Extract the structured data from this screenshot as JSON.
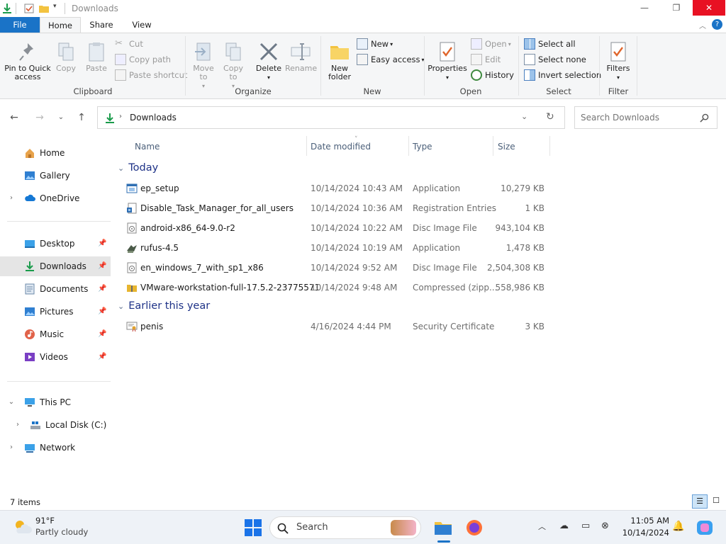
{
  "window": {
    "title": "Downloads"
  },
  "ribbon_tabs": [
    "File",
    "Home",
    "Share",
    "View"
  ],
  "ribbon": {
    "clipboard": {
      "label": "Clipboard",
      "pin": "Pin to Quick access",
      "copy": "Copy",
      "paste": "Paste",
      "cut": "Cut",
      "copy_path": "Copy path",
      "paste_shortcut": "Paste shortcut"
    },
    "organize": {
      "label": "Organize",
      "move_to": "Move to",
      "copy_to": "Copy to",
      "delete": "Delete",
      "rename": "Rename"
    },
    "new": {
      "label": "New",
      "new_folder": "New folder",
      "new_item": "New",
      "easy_access": "Easy access"
    },
    "open": {
      "label": "Open",
      "properties": "Properties",
      "open": "Open",
      "edit": "Edit",
      "history": "History"
    },
    "select": {
      "label": "Select",
      "select_all": "Select all",
      "select_none": "Select none",
      "invert": "Invert selection"
    },
    "filter": {
      "label": "Filter",
      "filters": "Filters"
    }
  },
  "address": {
    "path": "Downloads",
    "search_placeholder": "Search Downloads"
  },
  "nav": {
    "home": "Home",
    "gallery": "Gallery",
    "onedrive": "OneDrive",
    "desktop": "Desktop",
    "downloads": "Downloads",
    "documents": "Documents",
    "pictures": "Pictures",
    "music": "Music",
    "videos": "Videos",
    "this_pc": "This PC",
    "local_disk": "Local Disk (C:)",
    "network": "Network"
  },
  "columns": {
    "name": "Name",
    "date": "Date modified",
    "type": "Type",
    "size": "Size"
  },
  "groups": [
    {
      "label": "Today",
      "files": [
        {
          "name": "ep_setup",
          "date": "10/14/2024 10:43 AM",
          "type": "Application",
          "size": "10,279 KB",
          "icon": "app-icon"
        },
        {
          "name": "Disable_Task_Manager_for_all_users",
          "date": "10/14/2024 10:36 AM",
          "type": "Registration Entries",
          "size": "1 KB",
          "icon": "reg-icon"
        },
        {
          "name": "android-x86_64-9.0-r2",
          "date": "10/14/2024 10:22 AM",
          "type": "Disc Image File",
          "size": "943,104 KB",
          "icon": "disc-icon"
        },
        {
          "name": "rufus-4.5",
          "date": "10/14/2024 10:19 AM",
          "type": "Application",
          "size": "1,478 KB",
          "icon": "rufus-icon"
        },
        {
          "name": "en_windows_7_with_sp1_x86",
          "date": "10/14/2024 9:52 AM",
          "type": "Disc Image File",
          "size": "2,504,308 KB",
          "icon": "disc-icon"
        },
        {
          "name": "VMware-workstation-full-17.5.2-23775571",
          "date": "10/14/2024 9:48 AM",
          "type": "Compressed (zipp...",
          "size": "558,986 KB",
          "icon": "zip-icon"
        }
      ]
    },
    {
      "label": "Earlier this year",
      "files": [
        {
          "name": "penis",
          "date": "4/16/2024 4:44 PM",
          "type": "Security Certificate",
          "size": "3 KB",
          "icon": "certificate-icon"
        }
      ]
    }
  ],
  "status": {
    "items": "7 items"
  },
  "taskbar": {
    "temp": "91°F",
    "weather": "Partly cloudy",
    "search": "Search",
    "time": "11:05 AM",
    "date": "10/14/2024"
  }
}
